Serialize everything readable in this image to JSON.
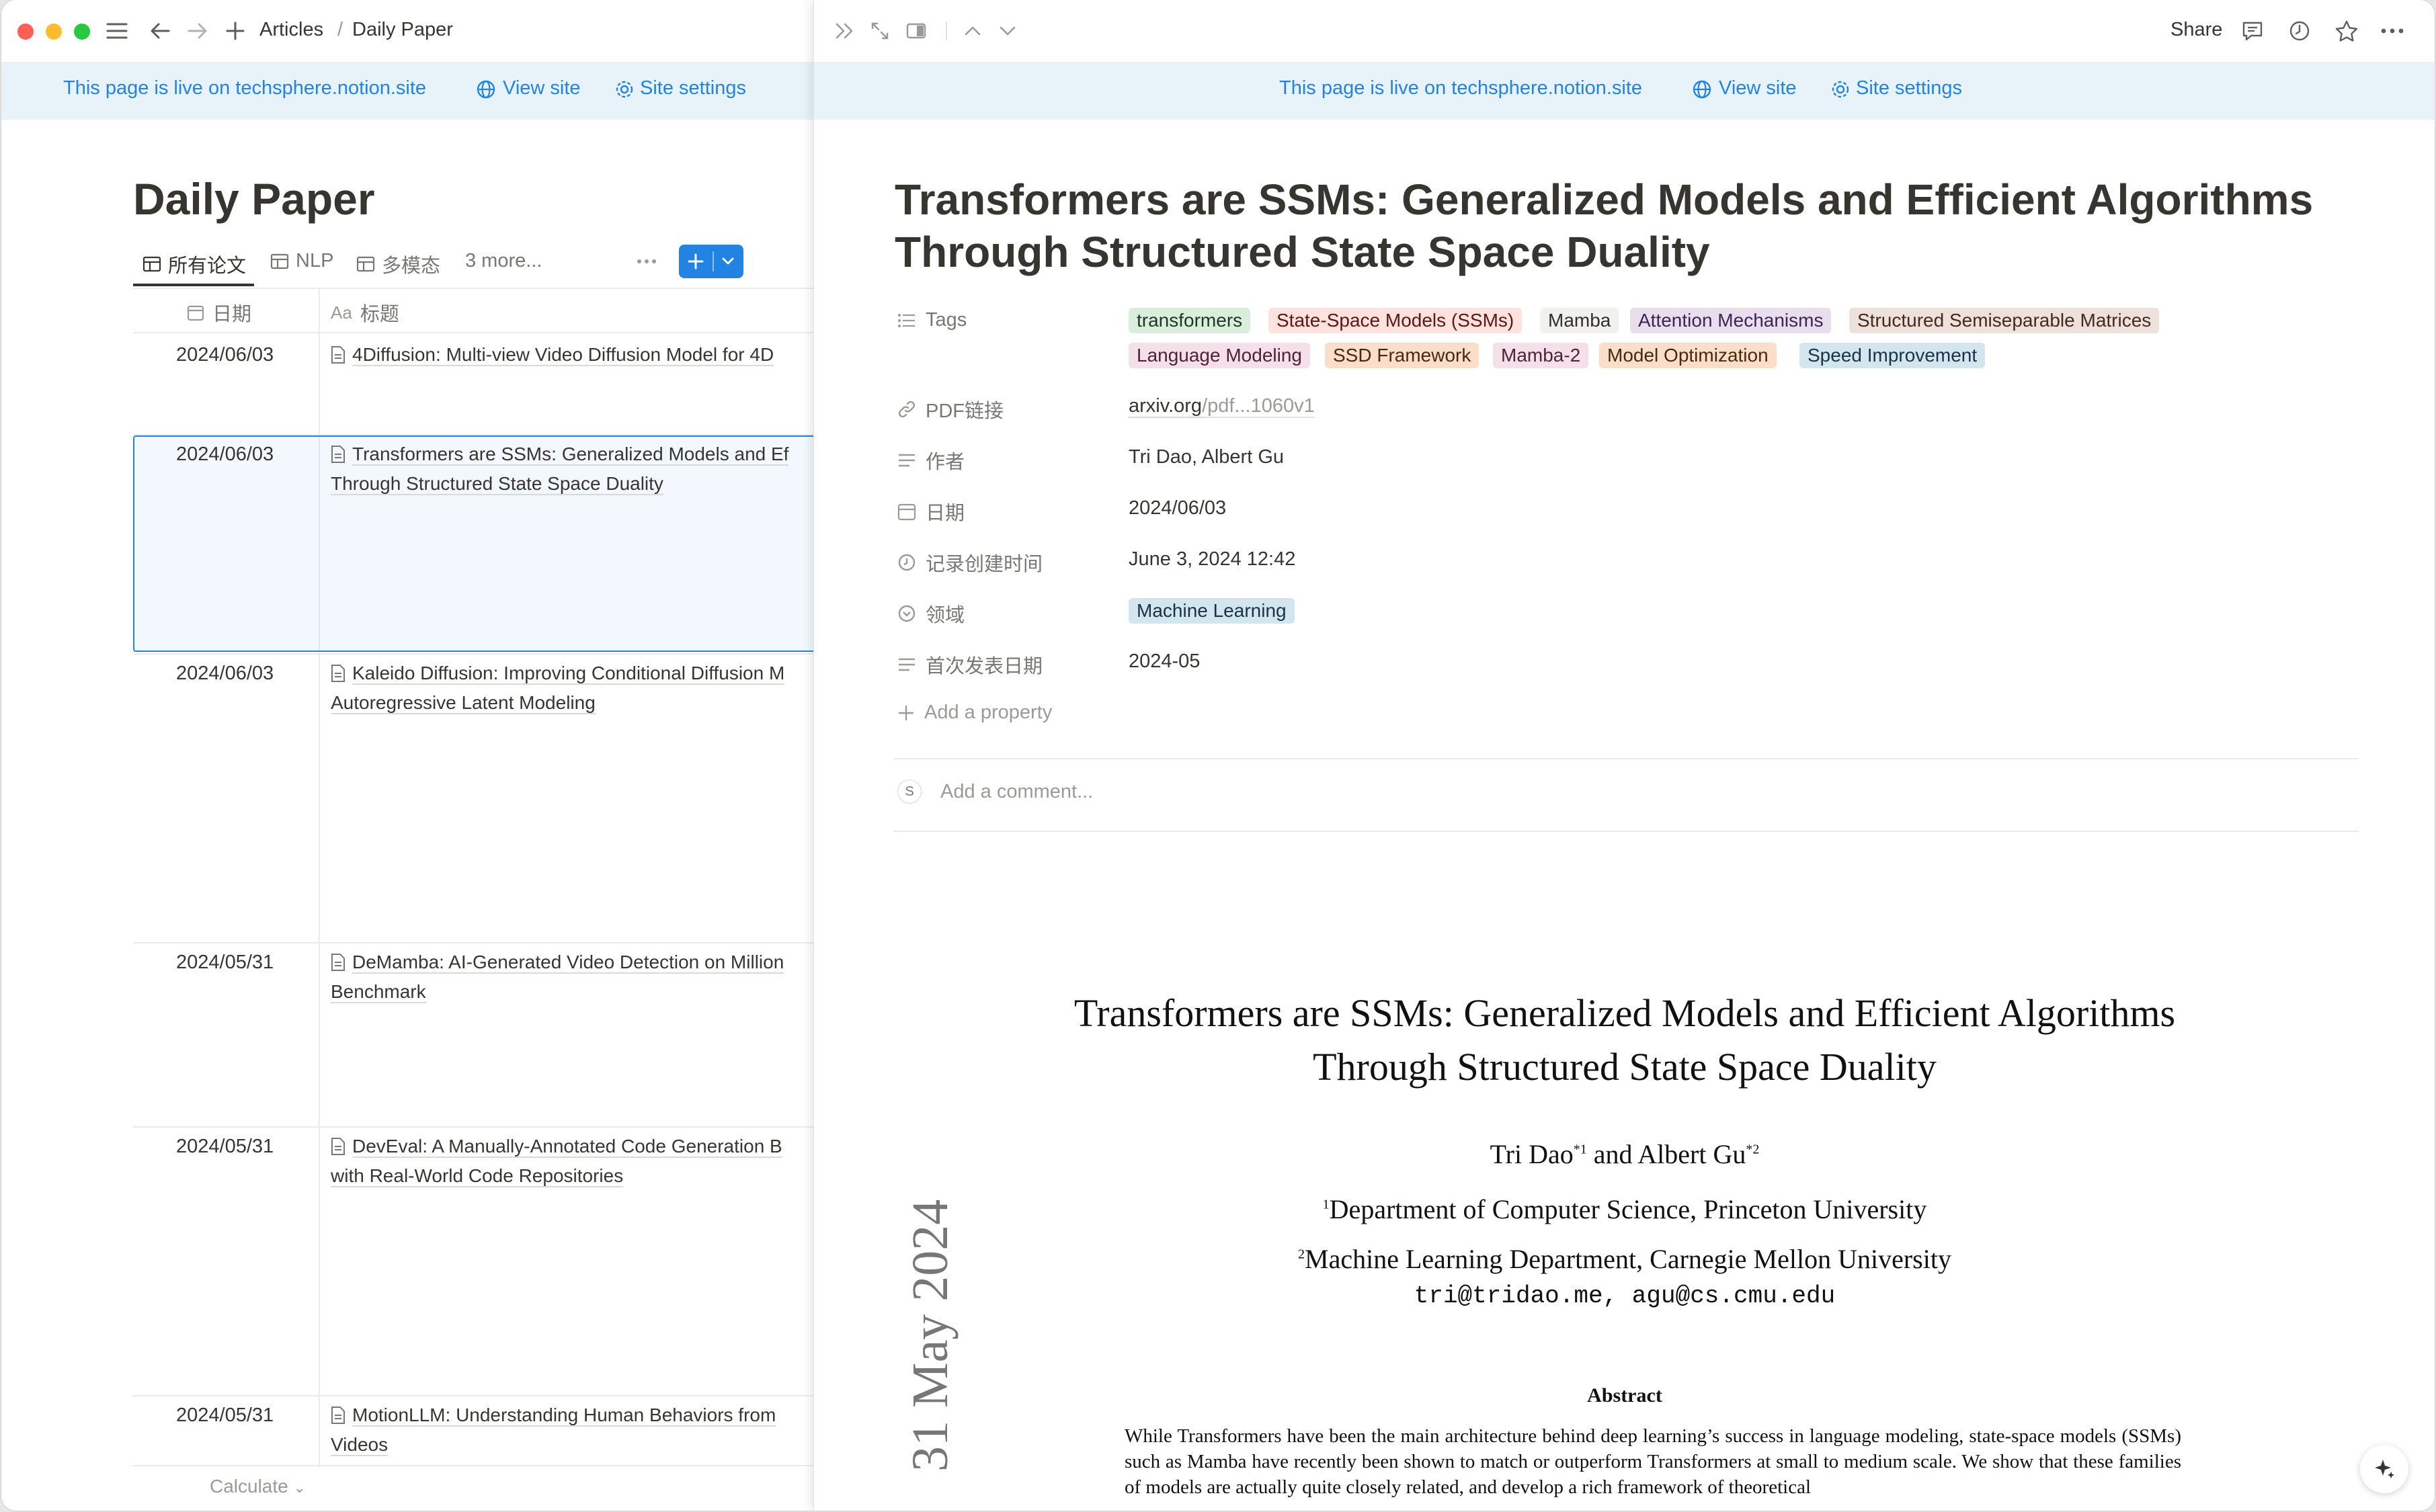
{
  "left": {
    "breadcrumb": {
      "parent": "Articles",
      "separator": "/",
      "current": "Daily Paper"
    },
    "banner": {
      "live_text": "This page is live on techsphere.notion.site",
      "view_site": "View site",
      "site_settings": "Site settings"
    },
    "page_title": "Daily Paper",
    "views": [
      {
        "label": "所有论文",
        "active": true
      },
      {
        "label": "NLP"
      },
      {
        "label": "多模态"
      }
    ],
    "more_views": "3 more...",
    "columns": {
      "date": "日期",
      "title": "标题"
    },
    "rows": [
      {
        "date": "2024/06/03",
        "title": "4Diffusion: Multi-view Video Diffusion Model for 4D"
      },
      {
        "date": "2024/06/03",
        "title": "Transformers are SSMs: Generalized Models and Ef",
        "title2": "Through Structured State Space Duality"
      },
      {
        "date": "2024/06/03",
        "title": "Kaleido Diffusion: Improving Conditional Diffusion M",
        "title2": "Autoregressive Latent Modeling"
      },
      {
        "date": "2024/05/31",
        "title": "DeMamba: AI-Generated Video Detection on Million",
        "title2": "Benchmark"
      },
      {
        "date": "2024/05/31",
        "title": "DevEval: A Manually-Annotated Code Generation B",
        "title2": "with Real-World Code Repositories"
      },
      {
        "date": "2024/05/31",
        "title": "MotionLLM: Understanding Human Behaviors from",
        "title2": "Videos"
      }
    ],
    "calculate": "Calculate"
  },
  "right": {
    "share": "Share",
    "banner": {
      "live_text": "This page is live on techsphere.notion.site",
      "view_site": "View site",
      "site_settings": "Site settings"
    },
    "title": "Transformers are SSMs: Generalized Models and Efficient Algorithms Through Structured State Space Duality",
    "props": {
      "tags_label": "Tags",
      "tags": [
        {
          "label": "transformers",
          "bg": "#dbeddb",
          "fg": "#1c3829"
        },
        {
          "label": "State-Space Models (SSMs)",
          "bg": "#ffe2dd",
          "fg": "#5d1715"
        },
        {
          "label": "Mamba",
          "bg": "#f1f1ef",
          "fg": "#32302c"
        },
        {
          "label": "Attention Mechanisms",
          "bg": "#e8deee",
          "fg": "#412454"
        },
        {
          "label": "Structured Semiseparable Matrices",
          "bg": "#eee0da",
          "fg": "#44291f"
        },
        {
          "label": "Language Modeling",
          "bg": "#f5e0e9",
          "fg": "#4c2337"
        },
        {
          "label": "SSD Framework",
          "bg": "#fadec9",
          "fg": "#49290e"
        },
        {
          "label": "Mamba-2",
          "bg": "#f5e0e9",
          "fg": "#4c2337"
        },
        {
          "label": "Model Optimization",
          "bg": "#fadec9",
          "fg": "#49290e"
        },
        {
          "label": "Speed Improvement",
          "bg": "#d3e5ef",
          "fg": "#183347"
        }
      ],
      "pdf_label": "PDF链接",
      "pdf_domain": "arxiv.org",
      "pdf_path": "/pdf...1060v1",
      "author_label": "作者",
      "authors": "Tri Dao, Albert Gu",
      "date_label": "日期",
      "date": "2024/06/03",
      "created_label": "记录创建时间",
      "created": "June 3, 2024 12:42",
      "domain_label": "领域",
      "domain_tag": "Machine Learning",
      "published_label": "首次发表日期",
      "published": "2024-05",
      "add_property": "Add a property"
    },
    "comment": {
      "avatar": "S",
      "placeholder": "Add a comment..."
    },
    "pdf": {
      "title_line1": "Transformers are SSMs: Generalized Models and Efficient Algorithms",
      "title_line2": "Through Structured State Space Duality",
      "author1": "Tri Dao",
      "author1_sup": "*1",
      "author_and": "and",
      "author2": "Albert Gu",
      "author2_sup": "*2",
      "affil1_sup": "1",
      "affil1": "Department of Computer Science, Princeton University",
      "affil2_sup": "2",
      "affil2": "Machine Learning Department, Carnegie Mellon University",
      "emails": "tri@tridao.me, agu@cs.cmu.edu",
      "abstract_heading": "Abstract",
      "abstract_text": "While Transformers have been the main architecture behind deep learning’s success in language modeling, state-space models (SSMs) such as Mamba have recently been shown to match or outperform Transformers at small to medium scale. We show that these families of models are actually quite closely related, and develop a rich framework of theoretical",
      "side_date": "31 May 2024"
    }
  }
}
